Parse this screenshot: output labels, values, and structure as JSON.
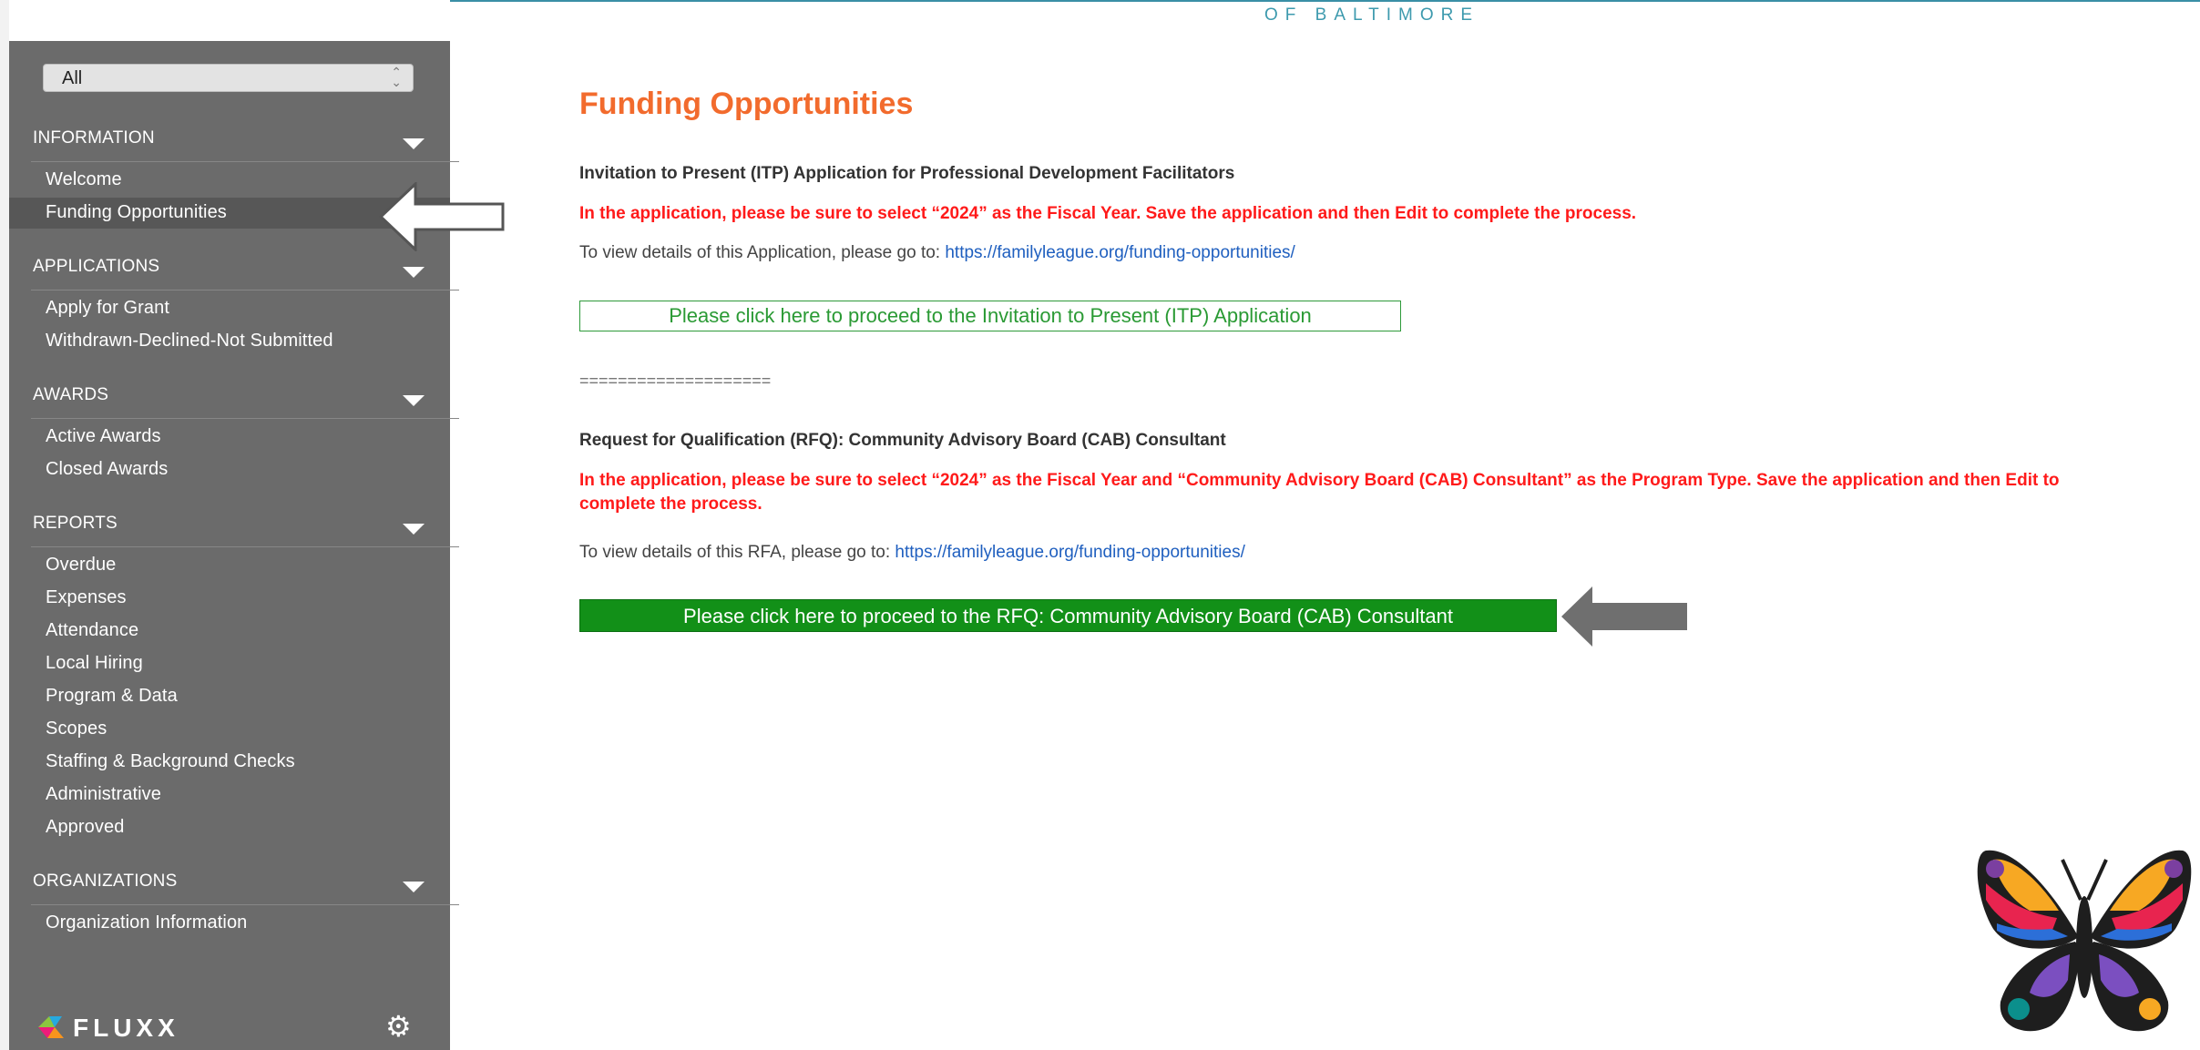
{
  "header": {
    "brand_subtitle": "OF BALTIMORE"
  },
  "sidebar": {
    "filter_value": "All",
    "sections": [
      {
        "label": "INFORMATION",
        "items": [
          "Welcome",
          "Funding Opportunities"
        ]
      },
      {
        "label": "APPLICATIONS",
        "items": [
          "Apply for Grant",
          "Withdrawn-Declined-Not Submitted"
        ]
      },
      {
        "label": "AWARDS",
        "items": [
          "Active Awards",
          "Closed Awards"
        ]
      },
      {
        "label": "REPORTS",
        "items": [
          "Overdue",
          "Expenses",
          "Attendance",
          "Local Hiring",
          "Program & Data",
          "Scopes",
          "Staffing & Background Checks",
          "Administrative",
          "Approved"
        ]
      },
      {
        "label": "ORGANIZATIONS",
        "items": [
          "Organization Information"
        ]
      }
    ],
    "active_item": "Funding Opportunities",
    "footer_logo": "FLUXX"
  },
  "main": {
    "title": "Funding Opportunities",
    "itp": {
      "heading": "Invitation to Present (ITP) Application for Professional Development Facilitators",
      "warning": "In the application, please be sure to select “2024” as the Fiscal Year. Save the application and then Edit to complete the process.",
      "details_prefix": " To view details of this Application, please go to: ",
      "details_link": "https://familyleague.org/funding-opportunities/",
      "button": "Please click here to proceed to the Invitation to Present (ITP) Application"
    },
    "separator": "====================",
    "rfq": {
      "heading": "Request for Qualification (RFQ): Community Advisory Board (CAB) Consultant",
      "warning": "In the application, please be sure to select “2024” as the Fiscal Year and “Community Advisory Board (CAB) Consultant” as the Program Type. Save the application and then Edit to complete the process.",
      "details_prefix": "To view details of this RFA, please go to: ",
      "details_link": "https://familyleague.org/funding-opportunities/",
      "button": "Please click here to proceed to the RFQ: Community Advisory Board (CAB) Consultant"
    }
  },
  "colors": {
    "sidebar_bg": "#6b6b6b",
    "title_orange": "#f26b2d",
    "warning_red": "#ff1a1a",
    "button_green": "#129018",
    "link_blue": "#1f5fbf"
  },
  "icons": [
    "select-chevron-icon",
    "section-collapse-icon",
    "fluxx-logo-icon",
    "gear-icon",
    "pointer-arrow-icon",
    "butterfly-logo-icon"
  ]
}
